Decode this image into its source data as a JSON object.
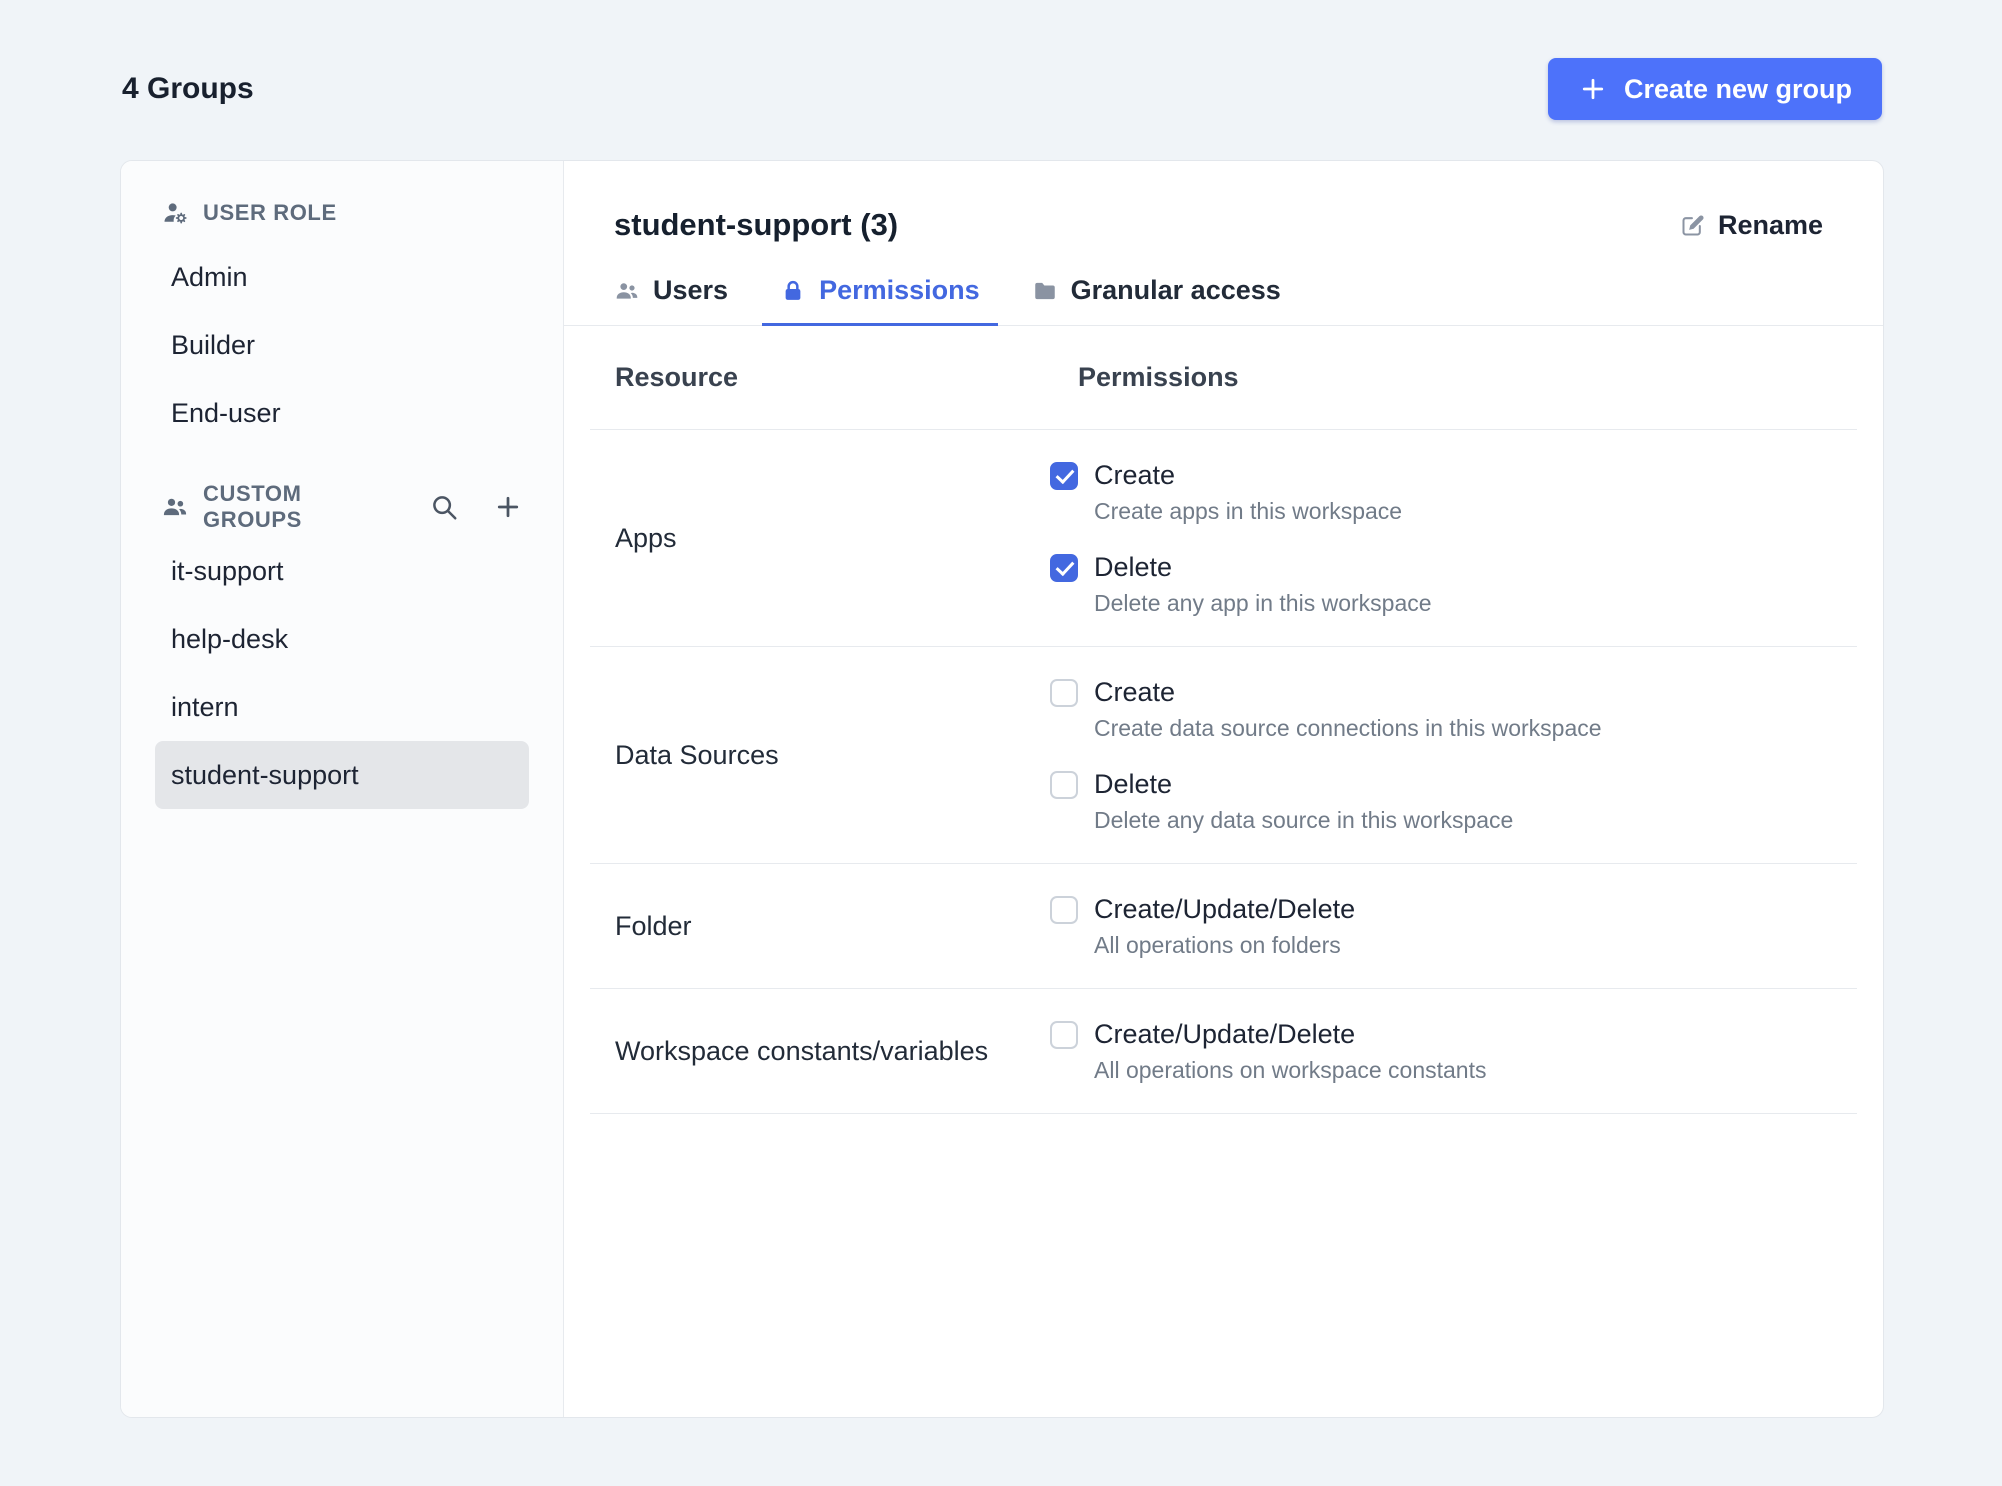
{
  "colors": {
    "background": "#F0F4F8",
    "accent": "#4D72FA",
    "accent_strong": "#4368E0",
    "selected_item_bg": "#E4E6E9"
  },
  "header": {
    "title": "4 Groups",
    "create_button": {
      "label": "Create new group",
      "icon": "plus-icon"
    }
  },
  "sidebar": {
    "user_role": {
      "header": "USER ROLE",
      "icon": "user-role-icon",
      "items": [
        {
          "label": "Admin",
          "selected": false
        },
        {
          "label": "Builder",
          "selected": false
        },
        {
          "label": "End-user",
          "selected": false
        }
      ]
    },
    "custom_groups": {
      "header": "CUSTOM GROUPS",
      "icon": "custom-groups-icon",
      "actions": [
        {
          "icon": "search-icon"
        },
        {
          "icon": "plus-icon"
        }
      ],
      "items": [
        {
          "label": "it-support",
          "selected": false
        },
        {
          "label": "help-desk",
          "selected": false
        },
        {
          "label": "intern",
          "selected": false
        },
        {
          "label": "student-support",
          "selected": true
        }
      ]
    }
  },
  "panel": {
    "title": "student-support (3)",
    "rename": {
      "label": "Rename",
      "icon": "edit-icon"
    },
    "tabs": [
      {
        "label": "Users",
        "icon": "users-icon",
        "active": false
      },
      {
        "label": "Permissions",
        "icon": "lock-icon",
        "active": true
      },
      {
        "label": "Granular access",
        "icon": "folder-icon",
        "active": false
      }
    ],
    "table": {
      "columns": [
        "Resource",
        "Permissions"
      ],
      "rows": [
        {
          "resource": "Apps",
          "permissions": [
            {
              "label": "Create",
              "description": "Create apps in this workspace",
              "checked": true
            },
            {
              "label": "Delete",
              "description": "Delete any app in this workspace",
              "checked": true
            }
          ]
        },
        {
          "resource": "Data Sources",
          "permissions": [
            {
              "label": "Create",
              "description": "Create data source connections in this workspace",
              "checked": false
            },
            {
              "label": "Delete",
              "description": "Delete any data source in this workspace",
              "checked": false
            }
          ]
        },
        {
          "resource": "Folder",
          "permissions": [
            {
              "label": "Create/Update/Delete",
              "description": "All operations on folders",
              "checked": false
            }
          ]
        },
        {
          "resource": "Workspace constants/variables",
          "permissions": [
            {
              "label": "Create/Update/Delete",
              "description": "All operations on workspace constants",
              "checked": false
            }
          ]
        }
      ]
    }
  }
}
